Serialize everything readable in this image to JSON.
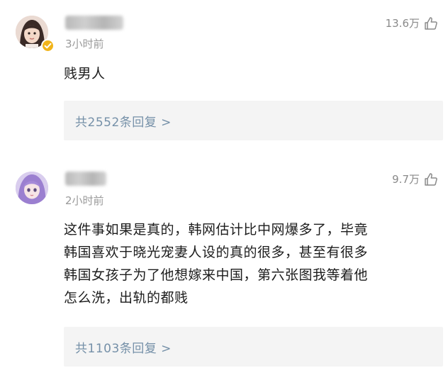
{
  "comments": [
    {
      "time": "3小时前",
      "likes": "13.6万",
      "text": "贱男人",
      "reply_summary": "共2552条回复 >",
      "avatar_icon": "avatar-girl-dark-hair",
      "verified": true
    },
    {
      "time": "2小时前",
      "likes": "9.7万",
      "text": "这件事如果是真的，韩网估计比中网爆多了，毕竟\n韩国喜欢于晓光宠妻人设的真的很多，甚至有很多\n韩国女孩子为了他想嫁来中国，第六张图我等着他\n怎么洗，出轨的都贱",
      "reply_summary": "共1103条回复 >",
      "avatar_icon": "avatar-girl-purple-hair",
      "verified": false
    }
  ],
  "colors": {
    "reply_link": "#7590a8",
    "reply_bg": "#f4f4f4",
    "meta_gray": "#9a9a9a",
    "verified_badge": "#f1b41a"
  }
}
